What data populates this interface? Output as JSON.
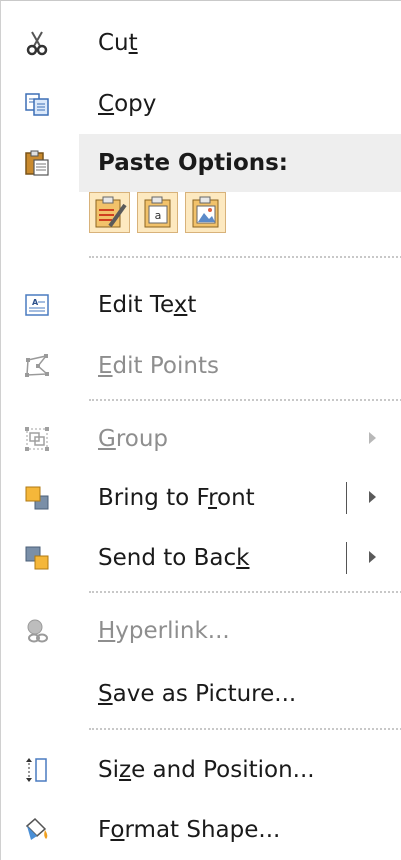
{
  "menu": {
    "cut": {
      "pre": "Cu",
      "key": "t",
      "post": ""
    },
    "copy": {
      "pre": "",
      "key": "C",
      "post": "opy"
    },
    "paste_options": "Paste Options:",
    "paste_buttons": [
      "paste-keep-formatting-icon",
      "paste-keep-text-only-icon",
      "paste-picture-icon"
    ],
    "edit_text": {
      "pre": "Edit Te",
      "key": "x",
      "post": "t"
    },
    "edit_points": {
      "pre": "",
      "key": "E",
      "post": "dit Points"
    },
    "group": {
      "pre": "",
      "key": "G",
      "post": "roup"
    },
    "bring_to_front": {
      "pre": "Bring to F",
      "key": "r",
      "post": "ont"
    },
    "send_to_back": {
      "pre": "Send to Bac",
      "key": "k",
      "post": ""
    },
    "hyperlink": {
      "pre": "",
      "key": "H",
      "post": "yperlink..."
    },
    "save_as_picture": {
      "pre": "",
      "key": "S",
      "post": "ave as Picture..."
    },
    "size_and_position": {
      "pre": "Si",
      "key": "z",
      "post": "e and Position..."
    },
    "format_shape": {
      "pre": "F",
      "key": "o",
      "post": "rmat Shape..."
    }
  },
  "colors": {
    "disabled_text": "#8e8e8e",
    "highlight_bg": "#eeeeee",
    "paste_button_bg": "#fde9c0"
  }
}
